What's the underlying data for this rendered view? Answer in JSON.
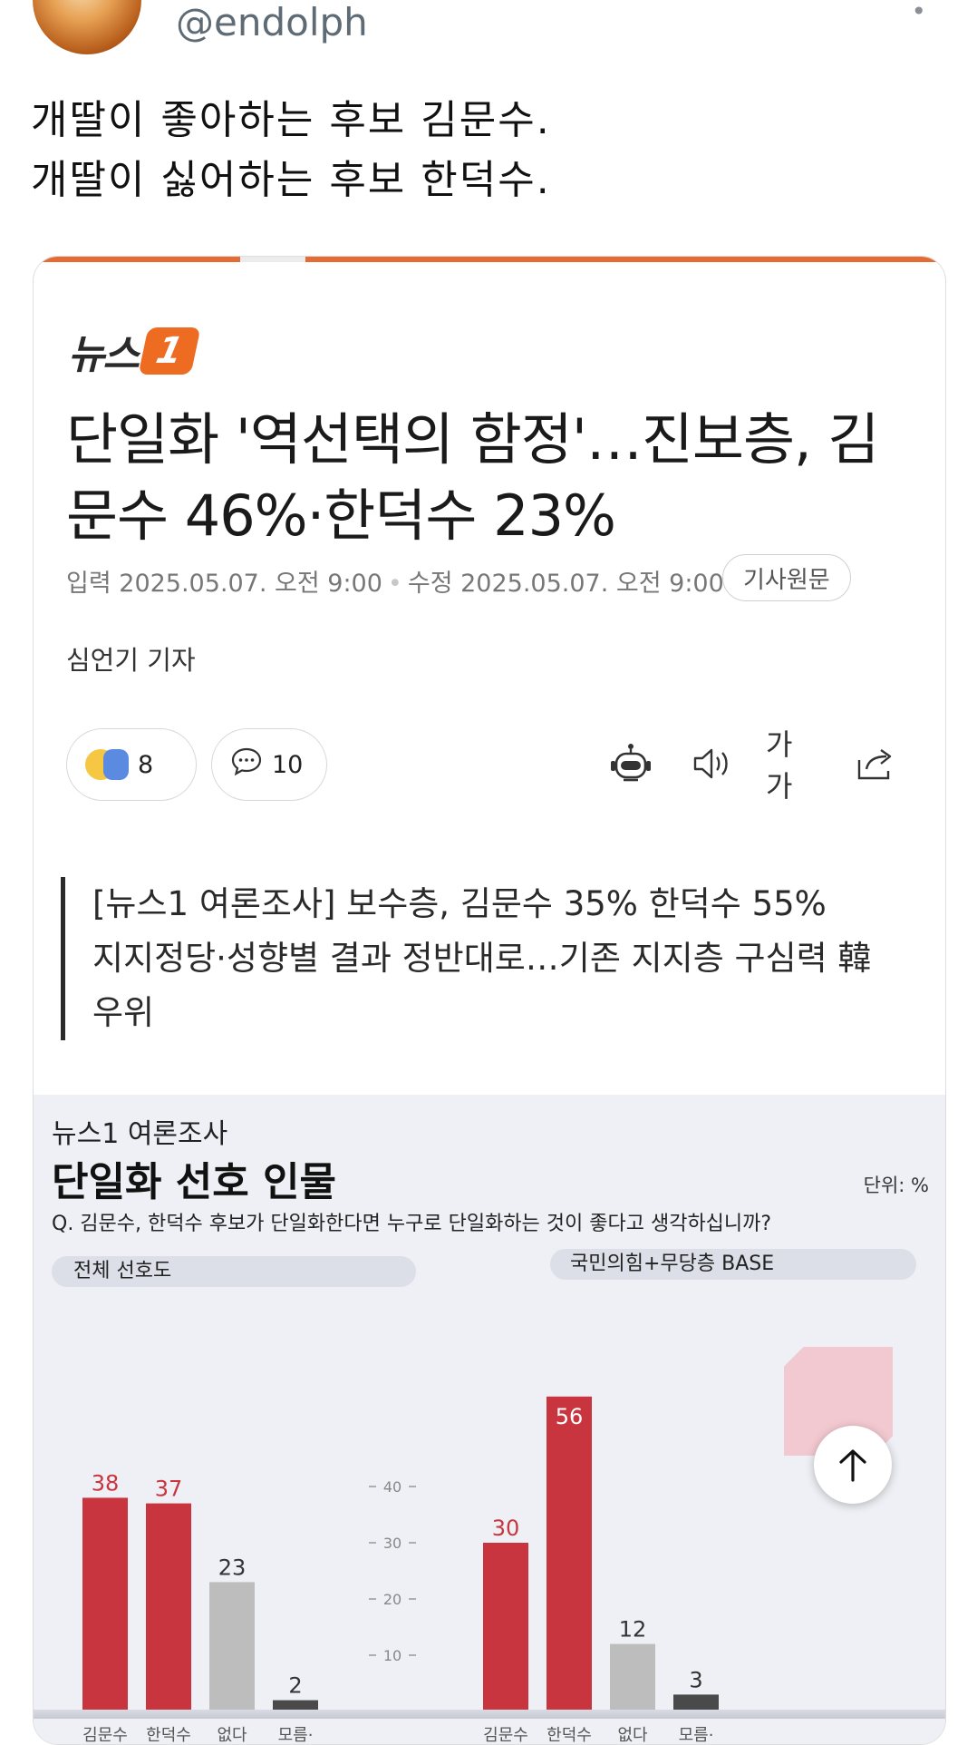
{
  "tweet": {
    "handle": "@endolph",
    "more": "•",
    "line1": "개딸이 좋아하는 후보 김문수.",
    "line2": "개딸이 싫어하는 후보 한덕수."
  },
  "article": {
    "logo_text": "뉴스",
    "logo_badge": "1",
    "headline": "단일화 '역선택의 함정'…진보층, 김문수 46%·한덕수 23%",
    "meta_input": "입력 2025.05.07. 오전 9:00",
    "meta_sep": "•",
    "meta_edit": "수정 2025.05.07. 오전 9:00",
    "original_button": "기사원문",
    "byline": "심언기 기자",
    "reaction_count": "8",
    "comment_count": "10",
    "fontsize_label": "가가",
    "quote_line1": "[뉴스1 여론조사] 보수층, 김문수 35% 한덕수 55%",
    "quote_line2": "지지정당·성향별 결과 정반대로…기존 지지층 구심력 韓",
    "quote_line3": "우위"
  },
  "infographic": {
    "kicker": "뉴스1 여론조사",
    "title": "단일화 선호 인물",
    "unit": "단위: %",
    "question": "Q. 김문수, 한덕수 후보가 단일화한다면 누구로 단일화하는 것이 좋다고 생각하십니까?",
    "left_panel_label": "전체 선호도",
    "right_panel_label": "국민의힘+무당층 BASE"
  },
  "chart_data": [
    {
      "type": "bar",
      "title": "전체 선호도",
      "categories": [
        "김문수",
        "한덕수",
        "없다",
        "모름·"
      ],
      "values": [
        38,
        37,
        23,
        2
      ],
      "colors": [
        "#c9353e",
        "#c9353e",
        "#bdbdbd",
        "#4a4a4a"
      ]
    },
    {
      "type": "bar",
      "title": "국민의힘+무당층 BASE",
      "categories": [
        "김문수",
        "한덕수",
        "없다",
        "모름·"
      ],
      "values": [
        30,
        56,
        12,
        3
      ],
      "colors": [
        "#c9353e",
        "#c9353e",
        "#bdbdbd",
        "#4a4a4a"
      ]
    }
  ],
  "axis_ticks": [
    "40",
    "30",
    "20",
    "10"
  ],
  "colors": {
    "accent_orange": "#e46b34",
    "bar_red": "#c9353e",
    "bar_gray": "#bdbdbd",
    "bar_dark": "#4a4a4a"
  }
}
